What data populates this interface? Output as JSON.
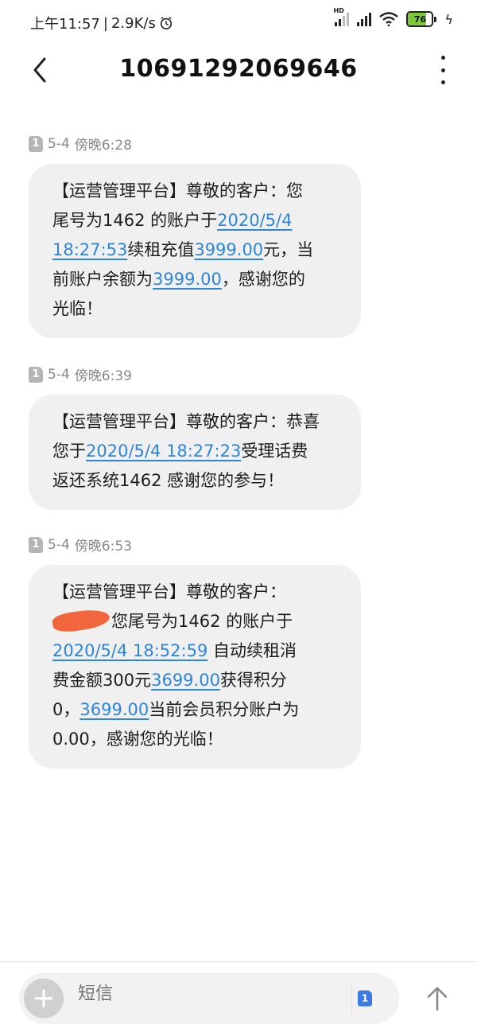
{
  "status_bar": {
    "time": "上午11:57",
    "speed": "2.9K/s",
    "signal_label": "HD",
    "battery": "76",
    "battery_level_percent": 76
  },
  "header": {
    "title": "10691292069646"
  },
  "messages": [
    {
      "sim": "1",
      "date": "5-4",
      "time": "傍晚6:28",
      "lines": [
        [
          {
            "t": "【运营管理平台】尊敬的客户：您"
          }
        ],
        [
          {
            "t": "尾号为1462 的账户于"
          },
          {
            "t": "2020/5/4",
            "link": true
          }
        ],
        [
          {
            "t": "18:27:53",
            "link": true
          },
          {
            "t": "续租充值"
          },
          {
            "t": "3999.00",
            "link": true
          },
          {
            "t": "元，当"
          }
        ],
        [
          {
            "t": "前账户余额为"
          },
          {
            "t": "3999.00",
            "link": true
          },
          {
            "t": "，感谢您的"
          }
        ],
        [
          {
            "t": "光临！"
          }
        ]
      ]
    },
    {
      "sim": "1",
      "date": "5-4",
      "time": "傍晚6:39",
      "lines": [
        [
          {
            "t": "【运营管理平台】尊敬的客户：恭喜"
          }
        ],
        [
          {
            "t": "您于"
          },
          {
            "t": "2020/5/4 18:27:23",
            "link": true
          },
          {
            "t": "受理话费"
          }
        ],
        [
          {
            "t": "返还系统1462  感谢您的参与！"
          }
        ]
      ]
    },
    {
      "sim": "1",
      "date": "5-4",
      "time": "傍晚6:53",
      "lines": [
        [
          {
            "t": "【运营管理平台】尊敬的客户："
          }
        ],
        [
          {
            "redact": true
          },
          {
            "t": "您尾号为1462 的账户于"
          }
        ],
        [
          {
            "t": "2020/5/4 18:52:59",
            "link": true
          },
          {
            "t": " 自动续租消"
          }
        ],
        [
          {
            "t": "费金额300元"
          },
          {
            "t": "3699.00",
            "link": true
          },
          {
            "t": "获得积分"
          }
        ],
        [
          {
            "t": "0，"
          },
          {
            "t": "3699.00",
            "link": true
          },
          {
            "t": "当前会员积分账户为"
          }
        ],
        [
          {
            "t": "0.00，感谢您的光临！"
          }
        ]
      ]
    }
  ],
  "input": {
    "placeholder": "短信",
    "sim_select": "1"
  },
  "icons": {
    "back": "back-arrow-icon",
    "more": "more-vertical-icon",
    "add": "plus-icon",
    "send": "send-arrow-icon"
  }
}
